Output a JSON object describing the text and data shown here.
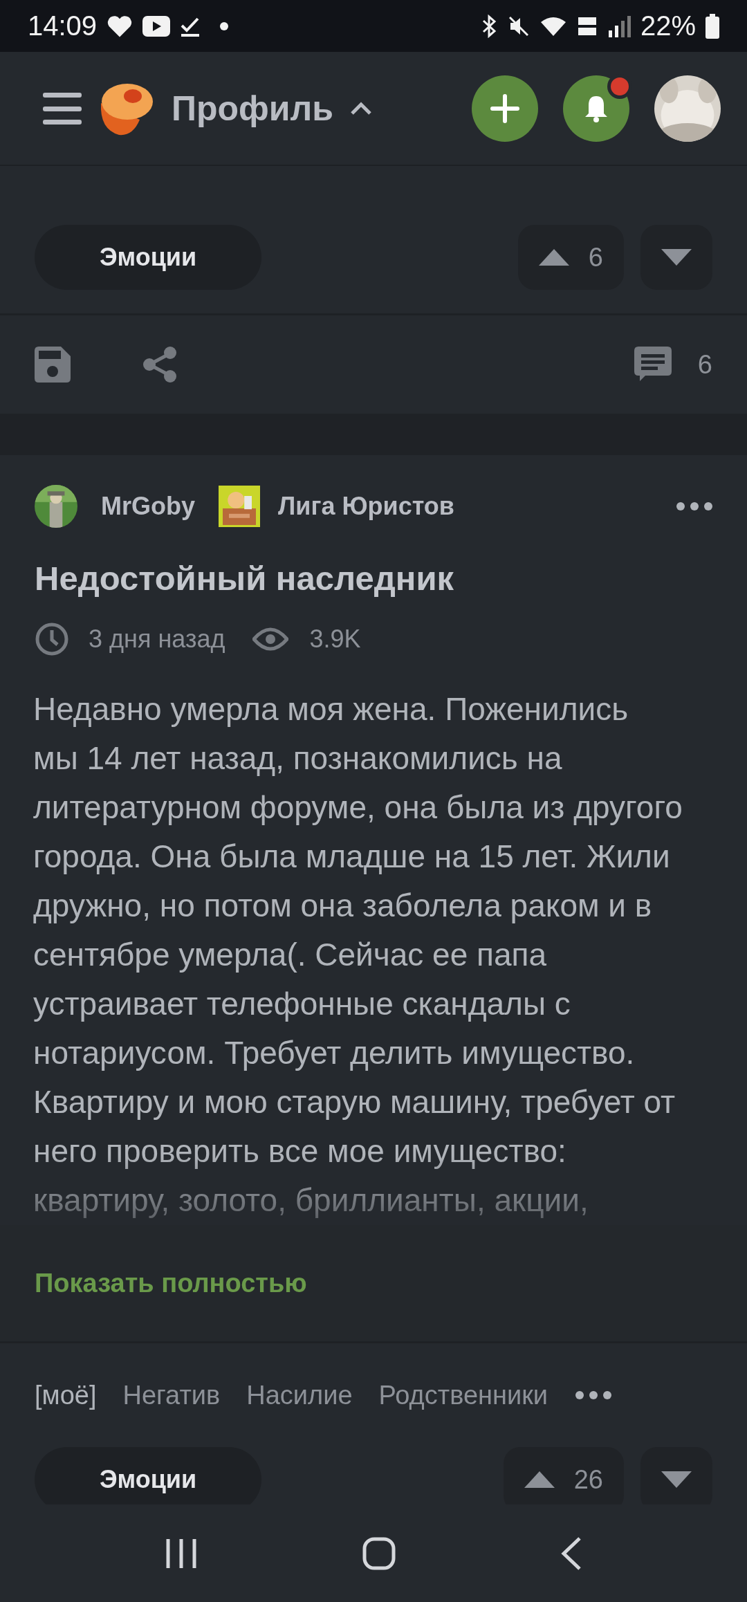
{
  "status_bar": {
    "time": "14:09",
    "battery": "22%"
  },
  "header": {
    "title": "Профиль",
    "has_unread": true
  },
  "previous_post": {
    "emotions": "Эмоции",
    "rating": "6",
    "comments": "6"
  },
  "post": {
    "author": "MrGoby",
    "community": "Лига Юристов",
    "title": "Недостойный наследник",
    "time": "3 дня назад",
    "views": "3.9K",
    "body_lines": [
      "Недавно умерла моя жена. Поженились",
      "мы 14 лет назад, познакомились на",
      "литературном форуме, она была из другого",
      "города. Она была младше на 15 лет. Жили",
      "дружно, но потом она заболела раком и в",
      "сентябре умерла(. Сейчас ее папа",
      "устраивает телефонные скандалы с",
      "нотариусом. Требует делить имущество.",
      "Квартиру и мою старую машину, требует от",
      "него проверить все мое имущество:",
      "квартиру, золото, бриллианты, акции,"
    ],
    "show_more": "Показать полностью",
    "tags": [
      "[моё]",
      "Негатив",
      "Насилие",
      "Родственники"
    ],
    "emotions": "Эмоции",
    "rating": "26"
  }
}
